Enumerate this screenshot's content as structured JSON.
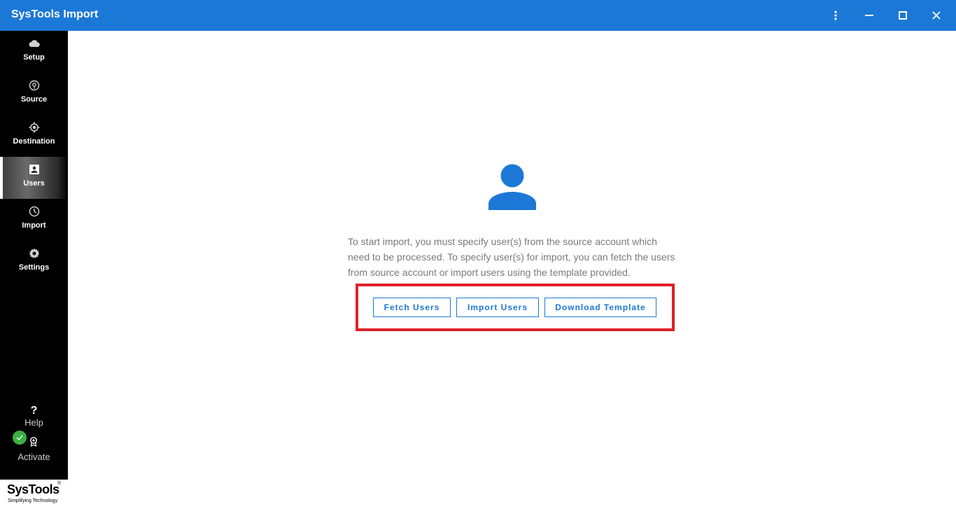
{
  "window": {
    "title": "SysTools Import"
  },
  "sidebar": {
    "items": [
      {
        "label": "Setup",
        "icon": "cloud-icon"
      },
      {
        "label": "Source",
        "icon": "source-icon"
      },
      {
        "label": "Destination",
        "icon": "destination-icon"
      },
      {
        "label": "Users",
        "icon": "users-icon",
        "active": true
      },
      {
        "label": "Import",
        "icon": "clock-icon"
      },
      {
        "label": "Settings",
        "icon": "gear-icon"
      }
    ],
    "help": {
      "label": "Help",
      "icon": "question-icon"
    },
    "activate": {
      "label": "Activate",
      "icon": "badge-icon"
    }
  },
  "brand": {
    "name": "SysTools",
    "registered": "®",
    "tagline": "Simplifying Technology"
  },
  "main": {
    "message": "To start import, you must specify user(s) from the source account which need to be processed. To specify user(s) for import, you can fetch the users from source account or import users using the template provided.",
    "buttons": {
      "fetch": "Fetch Users",
      "import": "Import Users",
      "download": "Download Template"
    }
  },
  "colors": {
    "accent": "#1c78d6",
    "highlight": "#e0202a",
    "sidebar": "#000000",
    "status_ok": "#3cb043"
  }
}
